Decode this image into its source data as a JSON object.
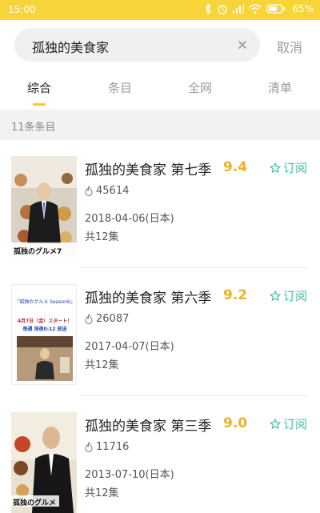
{
  "status_bar": {
    "time": "15:00",
    "battery": "65%"
  },
  "search": {
    "query": "孤独的美食家",
    "cancel_label": "取消"
  },
  "tabs": [
    {
      "label": "综合",
      "active": true
    },
    {
      "label": "条目",
      "active": false
    },
    {
      "label": "全网",
      "active": false
    },
    {
      "label": "清单",
      "active": false
    }
  ],
  "result_count": "11条条目",
  "items": [
    {
      "title": "孤独的美食家 第七季",
      "score": "9.4",
      "hot": "45614",
      "date": "2018-04-06(日本)",
      "episodes": "共12集",
      "subscribe_label": "订阅",
      "poster": {
        "text": "孤独のグルメ7"
      }
    },
    {
      "title": "孤独的美食家 第六季",
      "score": "9.2",
      "hot": "26087",
      "date": "2017-04-07(日本)",
      "episodes": "共12集",
      "subscribe_label": "订阅",
      "poster": {
        "text": "『孤独のグルメ Season6』",
        "line2": "4月7日（金）スタート！",
        "line3": "毎週 深夜0:12 放送"
      }
    },
    {
      "title": "孤独的美食家 第三季",
      "score": "9.0",
      "hot": "11716",
      "date": "2013-07-10(日本)",
      "episodes": "共12集",
      "subscribe_label": "订阅",
      "poster": {
        "text": "孤独のグルメ"
      }
    }
  ],
  "colors": {
    "accent_yellow": "#f6d43a",
    "score": "#f0b21e",
    "subscribe": "#3cc5a6"
  }
}
